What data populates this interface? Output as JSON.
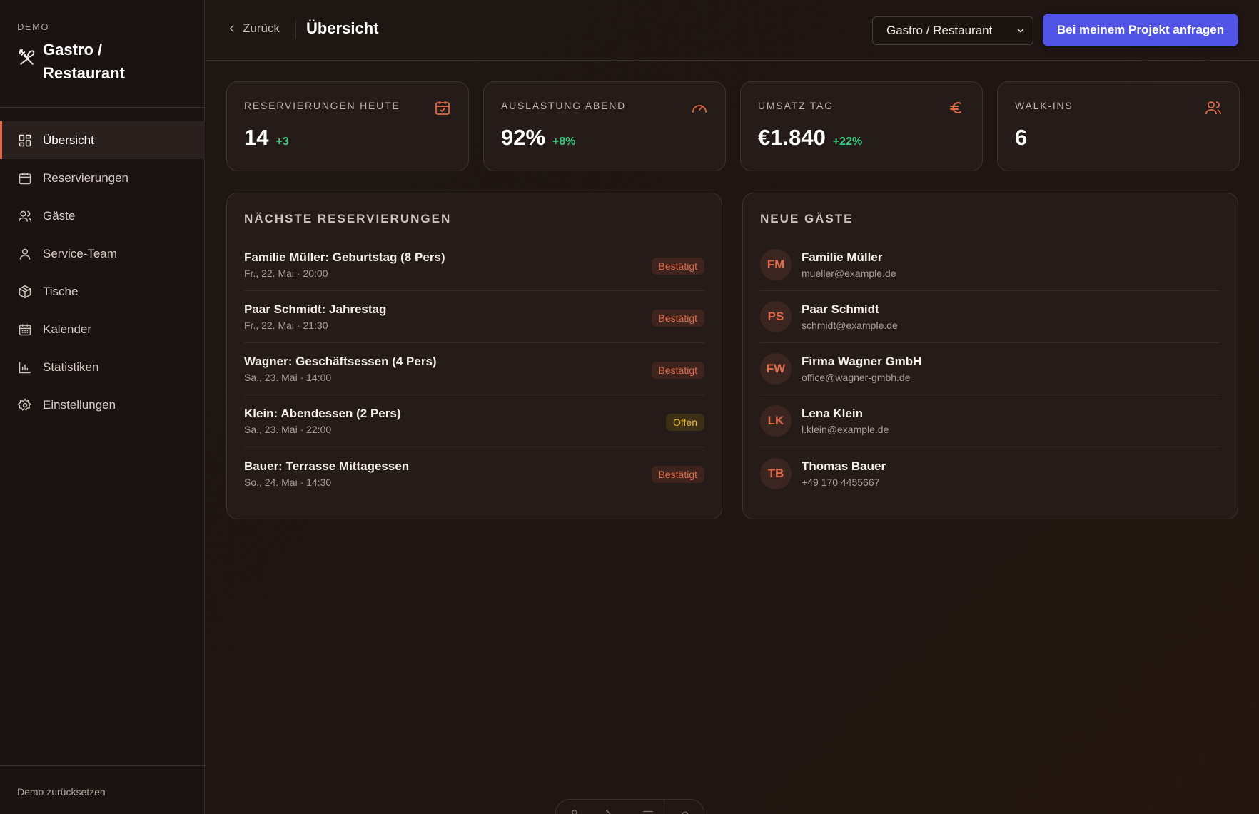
{
  "brand": {
    "demo_label": "DEMO",
    "title_line1": "Gastro /",
    "title_line2": "Restaurant",
    "icon": "utensils-crossed-icon"
  },
  "sidebar": {
    "items": [
      {
        "label": "Übersicht",
        "icon": "dashboard-grid-icon",
        "active": true
      },
      {
        "label": "Reservierungen",
        "icon": "calendar-icon"
      },
      {
        "label": "Gäste",
        "icon": "users-icon"
      },
      {
        "label": "Service-Team",
        "icon": "user-icon"
      },
      {
        "label": "Tische",
        "icon": "package-icon"
      },
      {
        "label": "Kalender",
        "icon": "calendar-days-icon"
      },
      {
        "label": "Statistiken",
        "icon": "bar-chart-icon"
      },
      {
        "label": "Einstellungen",
        "icon": "gear-icon"
      }
    ],
    "reset_label": "Demo zurücksetzen"
  },
  "header": {
    "back_label": "Zurück",
    "title": "Übersicht",
    "select_value": "Gastro / Restaurant",
    "cta_label": "Bei meinem Projekt anfragen"
  },
  "kpis": [
    {
      "label": "RESERVIERUNGEN HEUTE",
      "value": "14",
      "delta": "+3",
      "icon": "calendar-check-icon"
    },
    {
      "label": "AUSLASTUNG ABEND",
      "value": "92%",
      "delta": "+8%",
      "icon": "gauge-icon"
    },
    {
      "label": "UMSATZ TAG",
      "value": "€1.840",
      "delta": "+22%",
      "icon": "euro-icon"
    },
    {
      "label": "WALK-INS",
      "value": "6",
      "delta": "",
      "icon": "users-icon"
    }
  ],
  "reservations": {
    "title": "NÄCHSTE RESERVIERUNGEN",
    "items": [
      {
        "title": "Familie Müller: Geburtstag (8 Pers)",
        "sub": "Fr., 22. Mai · 20:00",
        "status": "Bestätigt"
      },
      {
        "title": "Paar Schmidt: Jahrestag",
        "sub": "Fr., 22. Mai · 21:30",
        "status": "Bestätigt"
      },
      {
        "title": "Wagner: Geschäftsessen (4 Pers)",
        "sub": "Sa., 23. Mai · 14:00",
        "status": "Bestätigt"
      },
      {
        "title": "Klein: Abendessen (2 Pers)",
        "sub": "Sa., 23. Mai · 22:00",
        "status": "Offen"
      },
      {
        "title": "Bauer: Terrasse Mittagessen",
        "sub": "So., 24. Mai · 14:30",
        "status": "Bestätigt"
      }
    ]
  },
  "guests": {
    "title": "NEUE GÄSTE",
    "items": [
      {
        "initials": "FM",
        "name": "Familie Müller",
        "contact": "mueller@example.de"
      },
      {
        "initials": "PS",
        "name": "Paar Schmidt",
        "contact": "schmidt@example.de"
      },
      {
        "initials": "FW",
        "name": "Firma Wagner GmbH",
        "contact": "office@wagner-gmbh.de"
      },
      {
        "initials": "LK",
        "name": "Lena Klein",
        "contact": "l.klein@example.de"
      },
      {
        "initials": "TB",
        "name": "Thomas Bauer",
        "contact": "+49 170 4455667"
      }
    ]
  },
  "colors": {
    "accent": "#e2694a",
    "cta": "#5053e4",
    "positive": "#3cc97e",
    "pending": "#e7b73c"
  }
}
